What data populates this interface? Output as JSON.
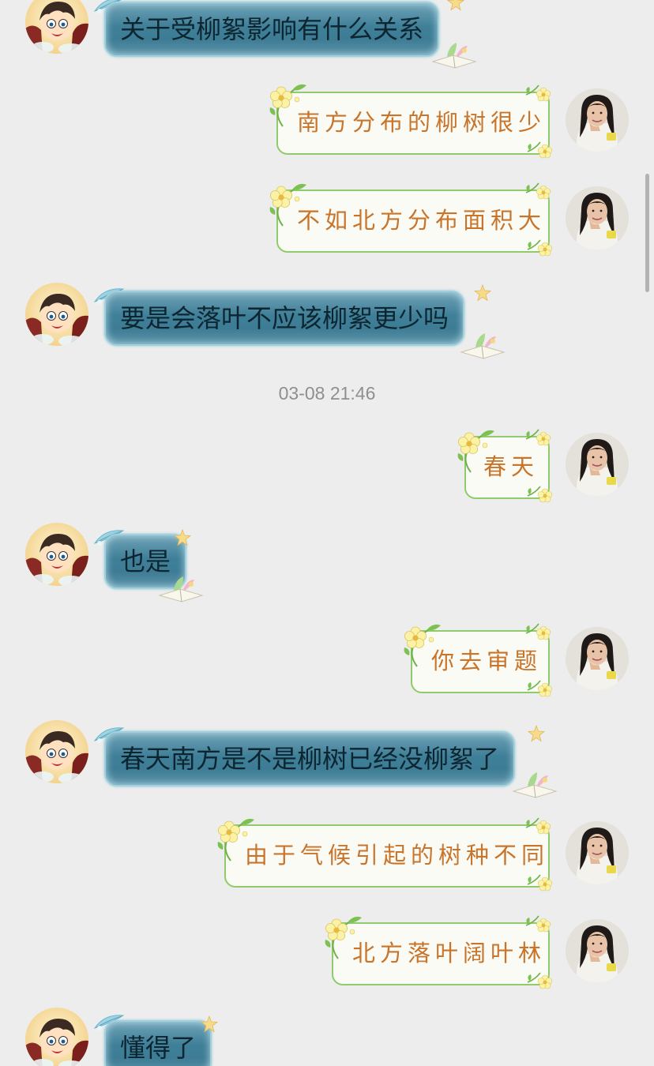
{
  "theme": {
    "background": "#ededed",
    "left_bubble_color": "#3f7f98",
    "right_bubble_border": "#8fca6c",
    "right_text_color": "#c8742a"
  },
  "timestamp": "03-08 21:46",
  "messages": [
    {
      "sender": "friend",
      "text": "关于受柳絮影响有什么关系"
    },
    {
      "sender": "me",
      "text": "南方分布的柳树很少"
    },
    {
      "sender": "me",
      "text": "不如北方分布面积大"
    },
    {
      "sender": "friend",
      "text": "要是会落叶不应该柳絮更少吗"
    },
    {
      "sender": "me",
      "text": "春天"
    },
    {
      "sender": "friend",
      "text": "也是"
    },
    {
      "sender": "me",
      "text": "你去审题"
    },
    {
      "sender": "friend",
      "text": "春天南方是不是柳树已经没柳絮了"
    },
    {
      "sender": "me",
      "text": "由于气候引起的树种不同"
    },
    {
      "sender": "me",
      "text": "北方落叶阔叶林"
    },
    {
      "sender": "friend",
      "text": "懂得了"
    }
  ]
}
